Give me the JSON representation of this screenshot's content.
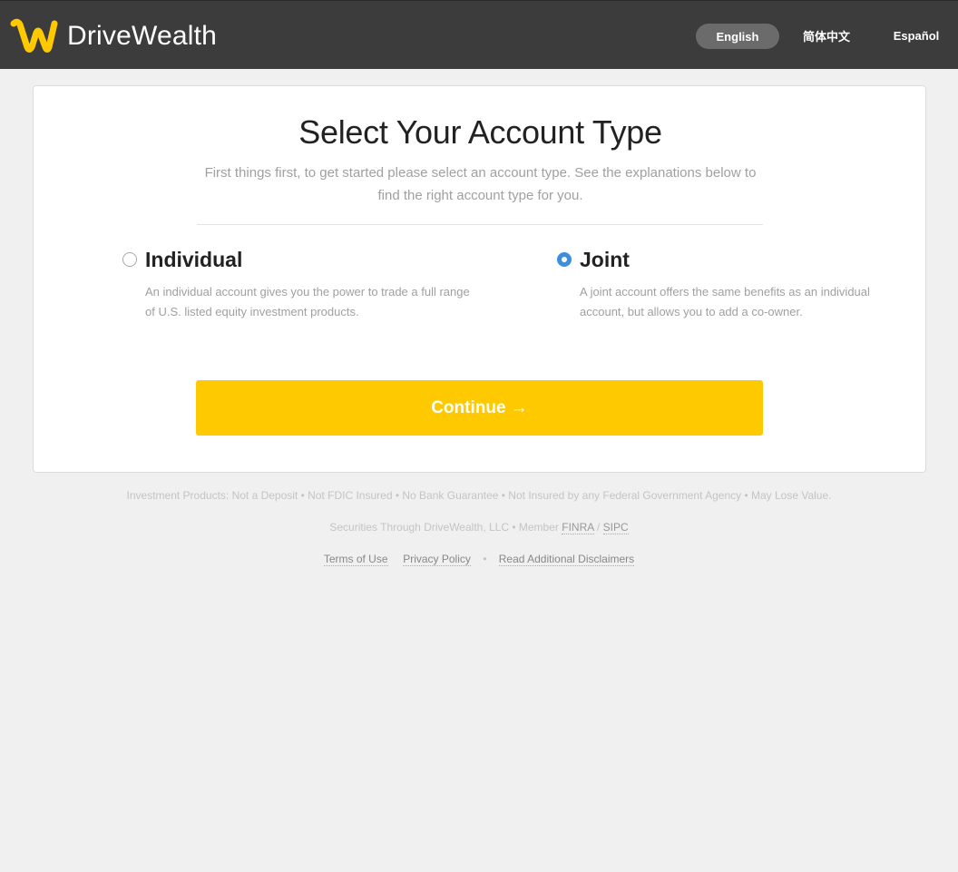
{
  "header": {
    "brand_part1": "Drive",
    "brand_part2": "Wealth",
    "logo_color": "#ffc900",
    "languages": [
      {
        "label": "English",
        "selected": true
      },
      {
        "label": "简体中文",
        "selected": false
      },
      {
        "label": "Español",
        "selected": false
      }
    ]
  },
  "main": {
    "title": "Select Your Account Type",
    "subtitle": "First things first, to get started please select an account type. See the explanations below to find the right account type for you.",
    "options": [
      {
        "label": "Individual",
        "description": "An individual account gives you the power to trade a full range of U.S. listed equity investment products.",
        "selected": false
      },
      {
        "label": "Joint",
        "description": "A joint account offers the same benefits as an individual account, but allows you to add a co-owner.",
        "selected": true
      }
    ],
    "continue_label": "Continue →",
    "accent_color": "#ffc900",
    "radio_selected_color": "#3d8fde"
  },
  "footer": {
    "disclaimer": "Investment Products: Not a Deposit • Not FDIC Insured • No Bank Guarantee • Not Insured by any Federal Government Agency • May Lose Value.",
    "securities_prefix": "Securities Through DriveWealth, LLC • Member",
    "finra": "FINRA",
    "slash": "/",
    "sipc": "SIPC",
    "links": {
      "terms": "Terms of Use",
      "privacy": "Privacy Policy",
      "bullet": "•",
      "disclaimers": "Read Additional Disclaimers"
    }
  }
}
